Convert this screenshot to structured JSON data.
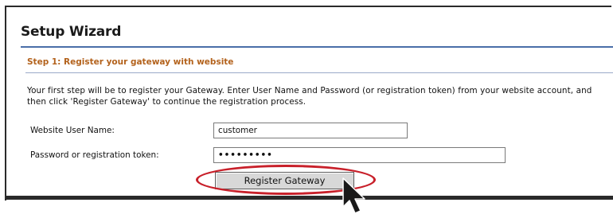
{
  "wizard": {
    "title": "Setup Wizard",
    "step_heading": "Step 1: Register your gateway with website",
    "description": "Your first step will be to register your Gateway. Enter User Name and Password (or registration token) from your website account, and then click 'Register Gateway' to continue the registration process.",
    "form": {
      "username_label": "Website User Name:",
      "username_value": "customer",
      "password_label": "Password or registration token:",
      "password_value": "•••••••••"
    },
    "register_button_label": "Register Gateway"
  },
  "colors": {
    "step_heading": "#b3621c",
    "title_rule": "#4a6ea8",
    "highlight_ellipse": "#c8202a",
    "button_bg": "#d8d8d8"
  },
  "icons": {
    "cursor": "mouse-pointer-icon"
  }
}
